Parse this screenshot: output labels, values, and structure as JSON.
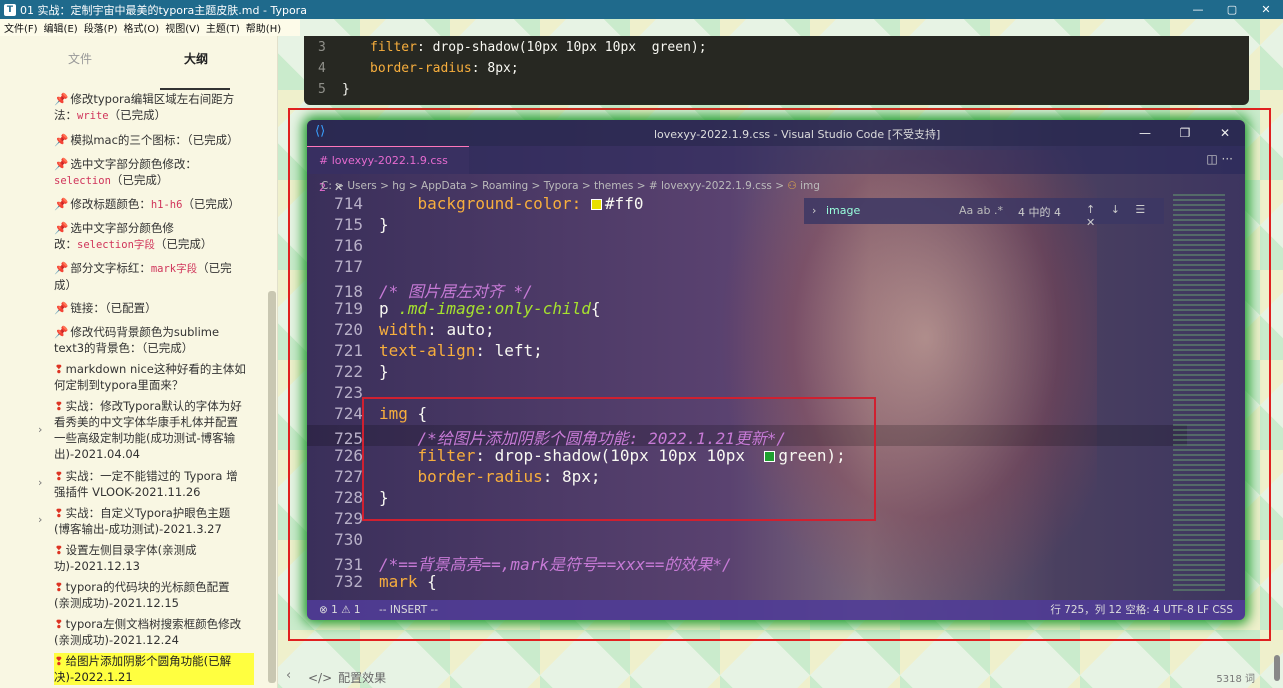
{
  "window": {
    "title": "01 实战：定制宇宙中最美的typora主题皮肤.md - Typora",
    "controls": [
      "—",
      "▢",
      "✕"
    ]
  },
  "menu": [
    "文件(F)",
    "编辑(E)",
    "段落(P)",
    "格式(O)",
    "视图(V)",
    "主题(T)",
    "帮助(H)"
  ],
  "sidebar": {
    "tab_files": "文件",
    "tab_outline": "大纲",
    "items": [
      {
        "l1": "修改typora编辑区域左右间距方",
        "l2a": "法：",
        "code": "write",
        "l2b": "（已完成）"
      },
      {
        "l1": "模拟mac的三个图标：（已完成）"
      },
      {
        "l1": "选中文字部分颜色修改：",
        "code": "selection",
        "l2b": "（已完成）"
      },
      {
        "l1": "修改标题颜色：",
        "code": "h1-h6",
        "tail": "（已完成）"
      },
      {
        "l1": "选中文字部分颜色修",
        "l2a": "改：",
        "code": "selection字段",
        "l2b": "（已完成）"
      },
      {
        "l1": "部分文字标红：",
        "code": "mark字段",
        "tail": "（已完",
        "l2": "成）"
      },
      {
        "l1": "链接：（已配置）"
      },
      {
        "l1": "修改代码背景颜色为sublime",
        "l2": "text3的背景色：（已完成）"
      },
      {
        "l1": "markdown nice这种好看的主体如",
        "l2": "何定制到typora里面来？"
      },
      {
        "l1": "实战：修改Typora默认的字体为好",
        "l2": "看秀美的中文字体华康手札体并配置",
        "l3": "一些高级定制功能(成功测试-博客输",
        "l4": "出)-2021.04.04"
      },
      {
        "l1": "实战：一定不能错过的 Typora 增",
        "l2": "强插件 VLOOK-2021.11.26"
      },
      {
        "l1": "实战：自定义Typora护眼色主题",
        "l2": "(博客输出-成功测试)-2021.3.27"
      },
      {
        "l1": "设置左侧目录字体(亲测成",
        "l2": "功)-2021.12.13"
      },
      {
        "l1": "typora的代码块的光标颜色配置",
        "l2": "(亲测成功)-2021.12.15"
      },
      {
        "l1": "typora左侧文档树搜索框颜色修改",
        "l2": "(亲测成功)-2021.12.24"
      },
      {
        "l1": "给图片添加阴影个圆角功能(已解",
        "l2": "决)-2022.1.21"
      }
    ]
  },
  "code_top": {
    "lines": [
      {
        "n": "3",
        "prop": "filter",
        "rest": "drop-shadow(10px 10px 10px  green);"
      },
      {
        "n": "4",
        "prop": "border-radius",
        "rest": "8px;"
      },
      {
        "n": "5",
        "text": "}"
      }
    ]
  },
  "vscode": {
    "title": "lovexyy-2022.1.9.css - Visual Studio Code [不受支持]",
    "tab": "# lovexyy-2022.1.9.css 2",
    "breadcrumb": "C: > Users > hg > AppData > Roaming > Typora > themes > # lovexyy-2022.1.9.css >",
    "breadcrumb_sym": "img",
    "find_query": "image",
    "find_opts": "Aa  ab  .*",
    "find_count": "4 中的 4",
    "find_nav": "↑ ↓ ☰ ✕",
    "status_left": "⊗ 1 ⚠ 1",
    "status_mode": "-- INSERT --",
    "status_right": "行 725，列 12   空格: 4   UTF-8   LF   CSS",
    "lines": [
      {
        "n": "714",
        "a": "    background-color: ",
        "sq": "#e8e000",
        "b": "#ff0"
      },
      {
        "n": "715",
        "a": "}"
      },
      {
        "n": "716",
        "a": ""
      },
      {
        "n": "717",
        "a": ""
      },
      {
        "n": "718",
        "cmt": "/* 图片居左对齐 */"
      },
      {
        "n": "719",
        "a": "p ",
        "cls": ".md-image:only-child",
        "b": "{"
      },
      {
        "n": "720",
        "prop": "width",
        "b": ": auto;"
      },
      {
        "n": "721",
        "prop": "text-align",
        "b": ": left;"
      },
      {
        "n": "722",
        "a": "}"
      },
      {
        "n": "723",
        "a": ""
      },
      {
        "n": "724",
        "sel": "img",
        "b": " {"
      },
      {
        "n": "725",
        "cmt": "    /*给图片添加阴影个圆角功能: 2022.1.21更新*/"
      },
      {
        "n": "726",
        "prop": "    filter",
        "b": ": drop-shadow(10px 10px 10px  ",
        "sq": "#1fa02f",
        "c": "green);"
      },
      {
        "n": "727",
        "prop": "    border-radius",
        "b": ": 8px;"
      },
      {
        "n": "728",
        "a": "}"
      },
      {
        "n": "729",
        "a": ""
      },
      {
        "n": "730",
        "a": ""
      },
      {
        "n": "731",
        "cmt": "/*==背景高亮==,mark是符号==xxx==的效果*/"
      },
      {
        "n": "732",
        "sel": "mark",
        "b": " {"
      }
    ]
  },
  "bottom": {
    "heading": "配置效果",
    "icon": "</>",
    "word_count": "5318 词"
  }
}
